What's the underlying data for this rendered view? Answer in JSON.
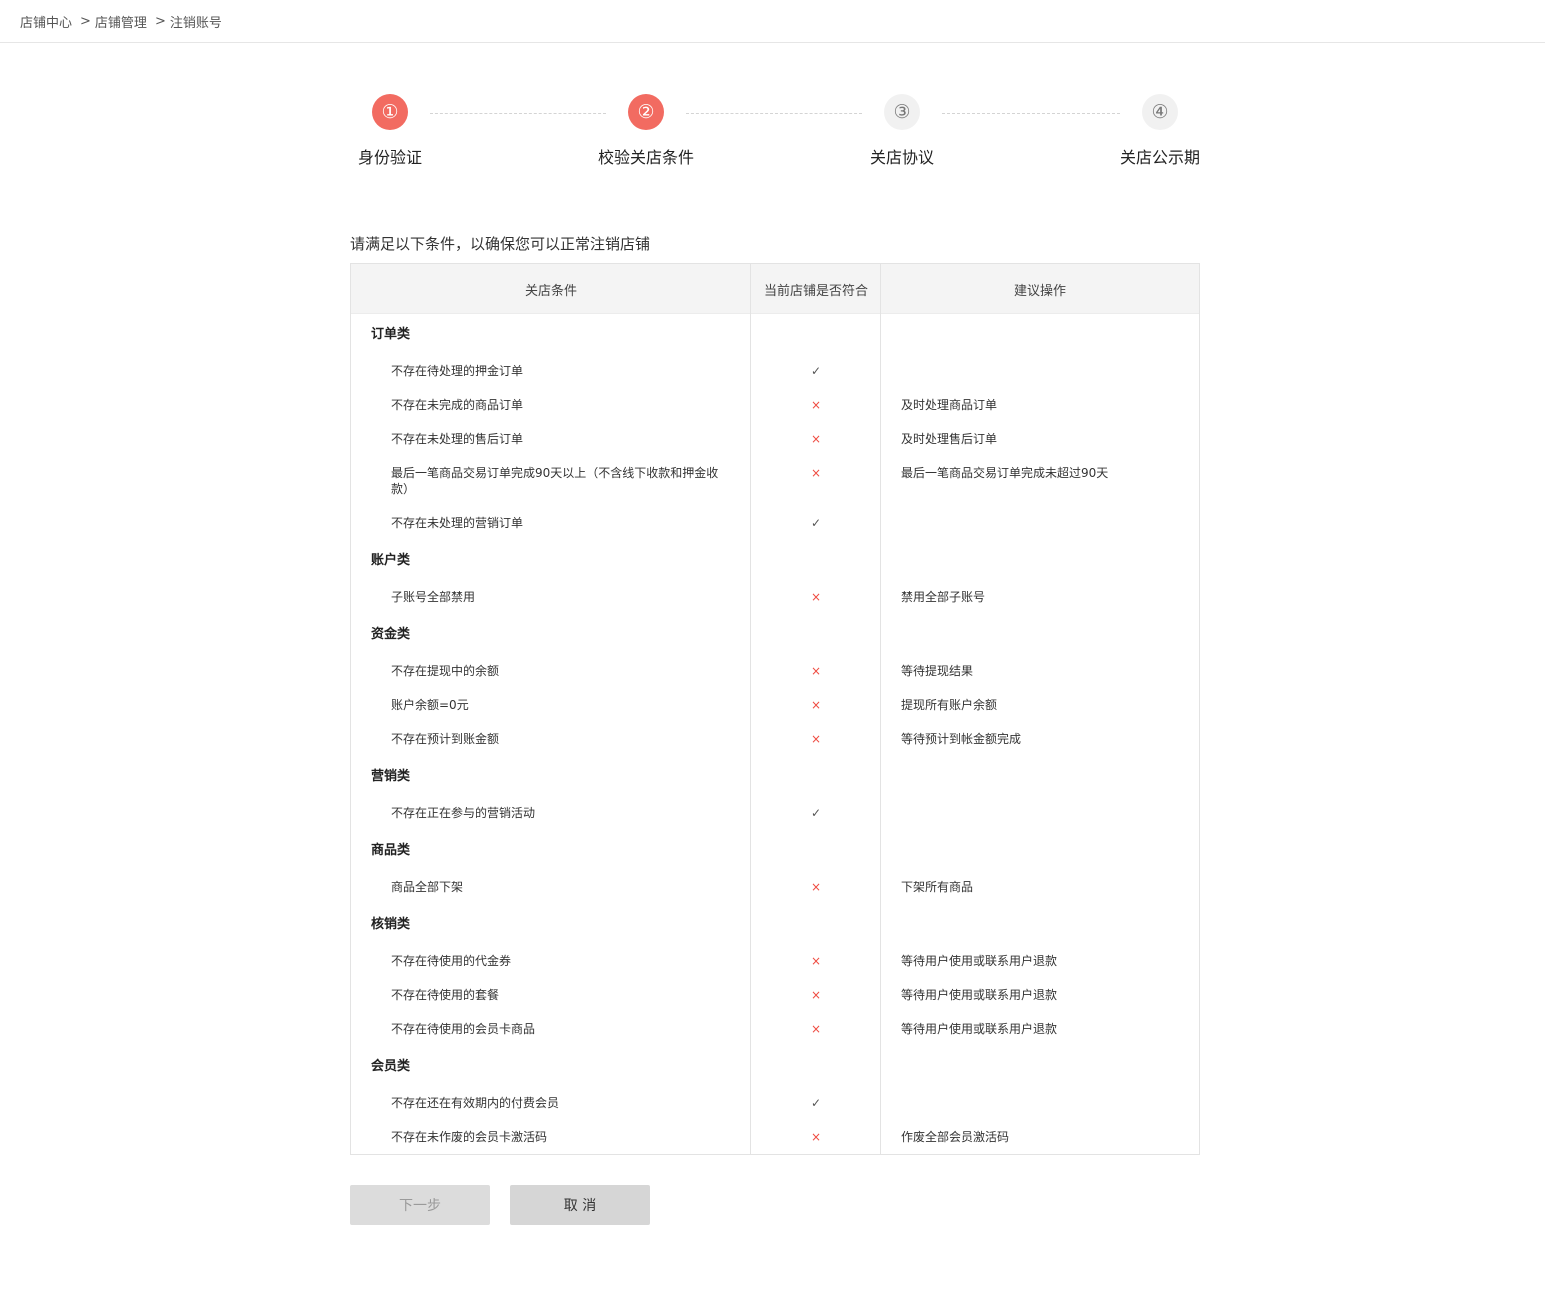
{
  "breadcrumb": [
    "店铺中心",
    "店铺管理",
    "注销账号"
  ],
  "breadcrumb_sep": ">",
  "steps": [
    {
      "num": "①",
      "label": "身份验证",
      "state": "active"
    },
    {
      "num": "②",
      "label": "校验关店条件",
      "state": "active"
    },
    {
      "num": "③",
      "label": "关店协议",
      "state": "inactive"
    },
    {
      "num": "④",
      "label": "关店公示期",
      "state": "inactive"
    }
  ],
  "intro": "请满足以下条件，以确保您可以正常注销店铺",
  "table": {
    "headers": [
      "关店条件",
      "当前店铺是否符合",
      "建议操作"
    ],
    "groups": [
      {
        "title": "订单类",
        "items": [
          {
            "cond": "不存在待处理的押金订单",
            "ok": true,
            "sugg": ""
          },
          {
            "cond": "不存在未完成的商品订单",
            "ok": false,
            "sugg": "及时处理商品订单"
          },
          {
            "cond": "不存在未处理的售后订单",
            "ok": false,
            "sugg": "及时处理售后订单"
          },
          {
            "cond": "最后一笔商品交易订单完成90天以上（不含线下收款和押金收款）",
            "ok": false,
            "sugg": "最后一笔商品交易订单完成未超过90天"
          },
          {
            "cond": "不存在未处理的营销订单",
            "ok": true,
            "sugg": ""
          }
        ]
      },
      {
        "title": "账户类",
        "items": [
          {
            "cond": "子账号全部禁用",
            "ok": false,
            "sugg": "禁用全部子账号"
          }
        ]
      },
      {
        "title": "资金类",
        "items": [
          {
            "cond": "不存在提现中的余额",
            "ok": false,
            "sugg": "等待提现结果"
          },
          {
            "cond": "账户余额=0元",
            "ok": false,
            "sugg": "提现所有账户余额"
          },
          {
            "cond": "不存在预计到账金额",
            "ok": false,
            "sugg": "等待预计到帐金额完成"
          }
        ]
      },
      {
        "title": "营销类",
        "items": [
          {
            "cond": "不存在正在参与的营销活动",
            "ok": true,
            "sugg": ""
          }
        ]
      },
      {
        "title": "商品类",
        "items": [
          {
            "cond": "商品全部下架",
            "ok": false,
            "sugg": "下架所有商品"
          }
        ]
      },
      {
        "title": "核销类",
        "items": [
          {
            "cond": "不存在待使用的代金券",
            "ok": false,
            "sugg": "等待用户使用或联系用户退款"
          },
          {
            "cond": "不存在待使用的套餐",
            "ok": false,
            "sugg": "等待用户使用或联系用户退款"
          },
          {
            "cond": "不存在待使用的会员卡商品",
            "ok": false,
            "sugg": "等待用户使用或联系用户退款"
          }
        ]
      },
      {
        "title": "会员类",
        "items": [
          {
            "cond": "不存在还在有效期内的付费会员",
            "ok": true,
            "sugg": ""
          },
          {
            "cond": "不存在未作废的会员卡激活码",
            "ok": false,
            "sugg": "作废全部会员激活码"
          }
        ]
      }
    ],
    "ok_glyph": "✓",
    "fail_glyph": "×"
  },
  "buttons": {
    "next": "下一步",
    "cancel": "取 消"
  }
}
